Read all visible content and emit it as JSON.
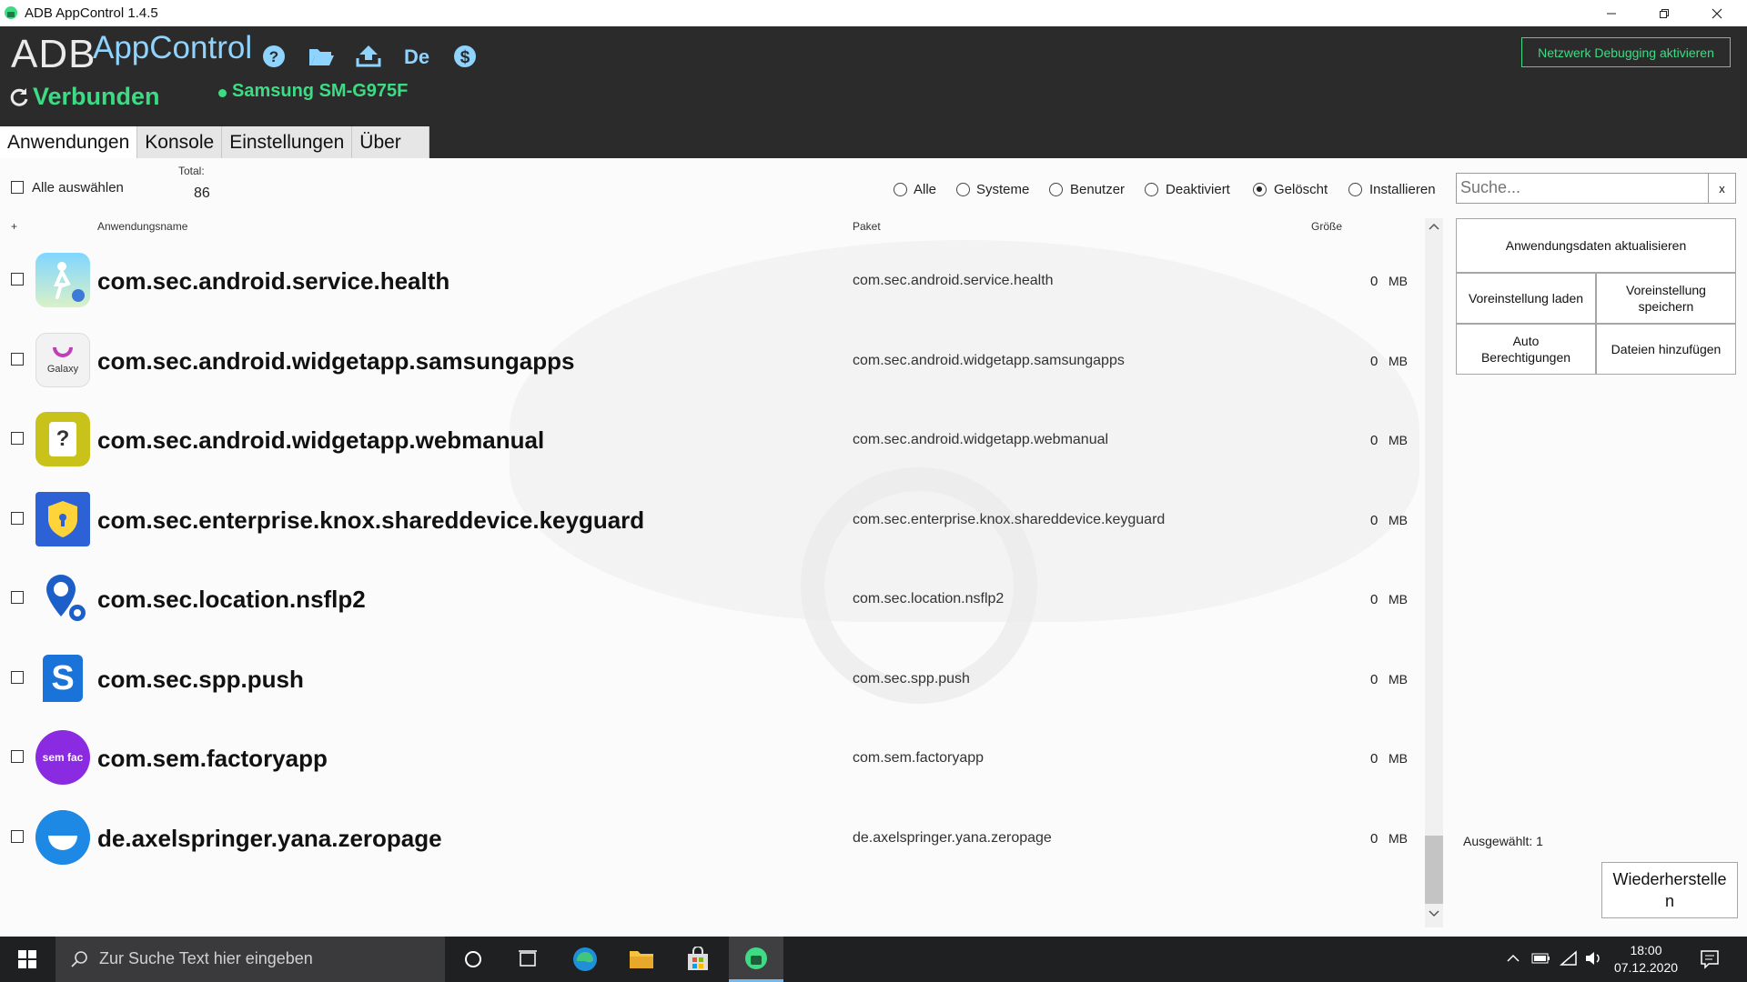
{
  "window": {
    "title": "ADB AppControl 1.4.5"
  },
  "header": {
    "logo_adb": "ADB",
    "logo_appcontrol": "AppControl",
    "connection_status": "Verbunden",
    "device_name": "Samsung SM-G975F",
    "network_button": "Netzwerk Debugging aktivieren",
    "toolbar_icons": [
      "help-icon",
      "folder-open-icon",
      "upload-icon",
      "de-language-icon",
      "donate-dollar-icon"
    ]
  },
  "tabs": [
    {
      "label": "Anwendungen",
      "active": true
    },
    {
      "label": "Konsole",
      "active": false
    },
    {
      "label": "Einstellungen",
      "active": false
    },
    {
      "label": "Über",
      "active": false
    }
  ],
  "list": {
    "select_all_label": "Alle auswählen",
    "total_label": "Total:",
    "total_value": "86",
    "columns": {
      "plus": "+",
      "name": "Anwendungsname",
      "package": "Paket",
      "size": "Größe"
    },
    "size_unit": "MB",
    "rows": [
      {
        "name": "com.sec.android.service.health",
        "package": "com.sec.android.service.health",
        "size": "0",
        "icon": "samsung-health-icon"
      },
      {
        "name": "com.sec.android.widgetapp.samsungapps",
        "package": "com.sec.android.widgetapp.samsungapps",
        "size": "0",
        "icon": "galaxy-store-icon",
        "icon_text": "Galaxy"
      },
      {
        "name": "com.sec.android.widgetapp.webmanual",
        "package": "com.sec.android.widgetapp.webmanual",
        "size": "0",
        "icon": "web-manual-icon",
        "icon_text": "?"
      },
      {
        "name": "com.sec.enterprise.knox.shareddevice.keyguard",
        "package": "com.sec.enterprise.knox.shareddevice.keyguard",
        "size": "0",
        "icon": "knox-shield-icon"
      },
      {
        "name": "com.sec.location.nsflp2",
        "package": "com.sec.location.nsflp2",
        "size": "0",
        "icon": "location-settings-icon"
      },
      {
        "name": "com.sec.spp.push",
        "package": "com.sec.spp.push",
        "size": "0",
        "icon": "samsung-push-icon",
        "icon_text": "S"
      },
      {
        "name": "com.sem.factoryapp",
        "package": "com.sem.factoryapp",
        "size": "0",
        "icon": "factory-app-icon",
        "icon_text": "sem fac"
      },
      {
        "name": "de.axelspringer.yana.zeropage",
        "package": "de.axelspringer.yana.zeropage",
        "size": "0",
        "icon": "upday-icon"
      }
    ]
  },
  "filters": [
    {
      "label": "Alle",
      "selected": false
    },
    {
      "label": "Systeme",
      "selected": false
    },
    {
      "label": "Benutzer",
      "selected": false
    },
    {
      "label": "Deaktiviert",
      "selected": false
    },
    {
      "label": "Gelöscht",
      "selected": true
    },
    {
      "label": "Installieren",
      "selected": false
    }
  ],
  "search": {
    "placeholder": "Suche...",
    "clear": "x"
  },
  "right_panel": {
    "refresh_button": "Anwendungsdaten aktualisieren",
    "load_preset": "Voreinstellung laden",
    "save_preset": "Voreinstellung speichern",
    "auto_permissions": "Auto Berechtigungen",
    "add_files": "Dateien hinzufügen",
    "selected_label": "Ausgewählt: 1",
    "restore_button": "Wiederherstellen"
  },
  "taskbar": {
    "search_placeholder": "Zur Suche Text hier eingeben",
    "time": "18:00",
    "date": "07.12.2020"
  },
  "colors": {
    "accent_green": "#3ddc84",
    "header_bg": "#2b2b2b",
    "logo_blue": "#8fd3ff",
    "taskbar_bg": "#1f2022"
  }
}
